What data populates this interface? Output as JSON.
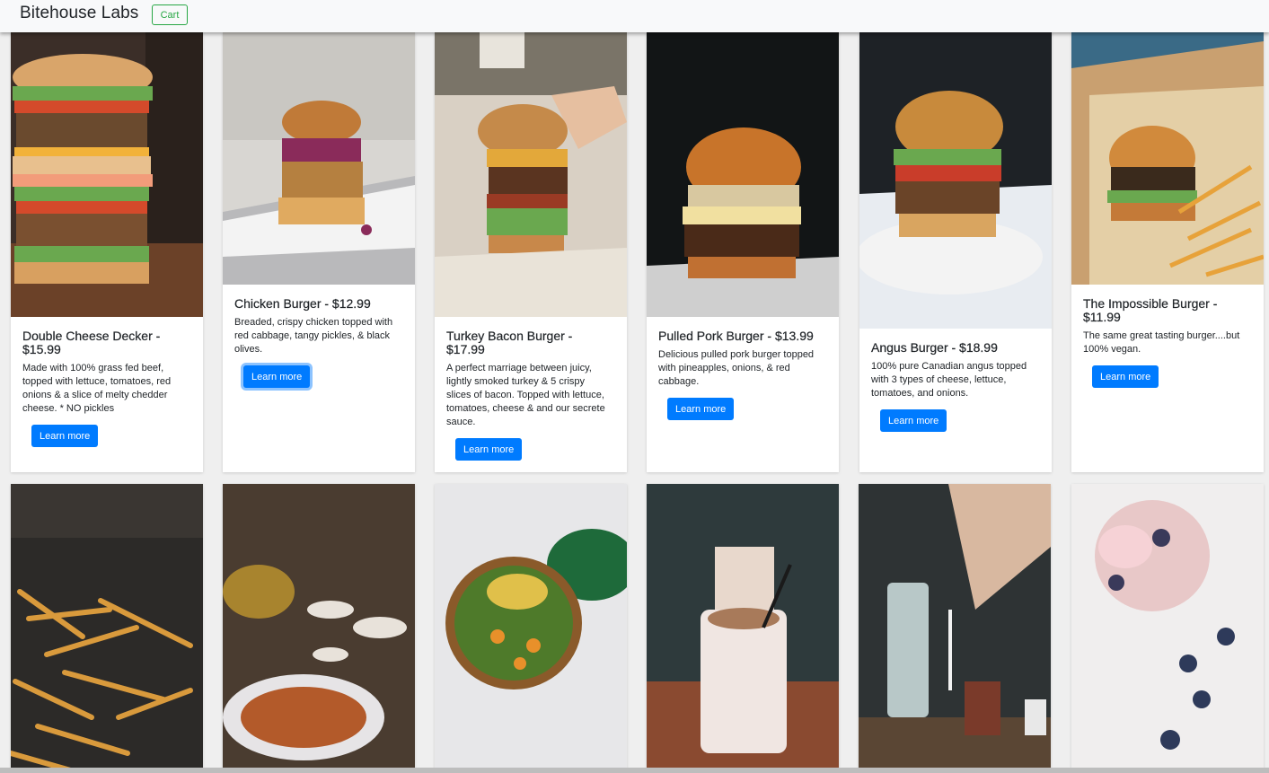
{
  "navbar": {
    "brand": "Bitehouse Labs",
    "cart_label": "Cart"
  },
  "colors": {
    "primary": "#007bff",
    "success": "#28a745",
    "card_bg": "#ffffff",
    "page_bg": "#efefef"
  },
  "menu_items": [
    {
      "title": "Double Cheese Decker - $15.99",
      "description": "Made with 100% grass fed beef, topped with lettuce, tomatoes, red onions & a slice of melty chedder cheese. * NO pickles",
      "button_label": "Learn more",
      "image": "double-cheese-burger-photo"
    },
    {
      "title": "Chicken Burger - $12.99",
      "description": "Breaded, crispy chicken topped with red cabbage, tangy pickles, & black olives.",
      "button_label": "Learn more",
      "image": "chicken-burger-photo"
    },
    {
      "title": "Turkey Bacon Burger - $17.99",
      "description": "A perfect marriage between juicy, lightly smoked turkey & 5 crispy slices of bacon. Topped with lettuce, tomatoes, cheese & and our secrete sauce.",
      "button_label": "Learn more",
      "image": "turkey-bacon-burger-photo"
    },
    {
      "title": "Pulled Pork Burger - $13.99",
      "description": "Delicious pulled pork burger topped with pineapples, onions, & red cabbage.",
      "button_label": "Learn more",
      "image": "pulled-pork-burger-photo"
    },
    {
      "title": "Angus Burger - $18.99",
      "description": "100% pure Canadian angus topped with 3 types of cheese, lettuce, tomatoes, and onions.",
      "button_label": "Learn more",
      "image": "angus-burger-photo"
    },
    {
      "title": "The Impossible Burger - $11.99",
      "description": "The same great tasting burger....but 100% vegan.",
      "button_label": "Learn more",
      "image": "impossible-burger-photo"
    }
  ],
  "second_row": [
    {
      "image": "french-fries-photo"
    },
    {
      "image": "sweet-potato-fries-photo"
    },
    {
      "image": "salad-bowl-photo"
    },
    {
      "image": "milkshake-photo"
    },
    {
      "image": "cold-brew-photo"
    },
    {
      "image": "smoothie-photo"
    }
  ]
}
